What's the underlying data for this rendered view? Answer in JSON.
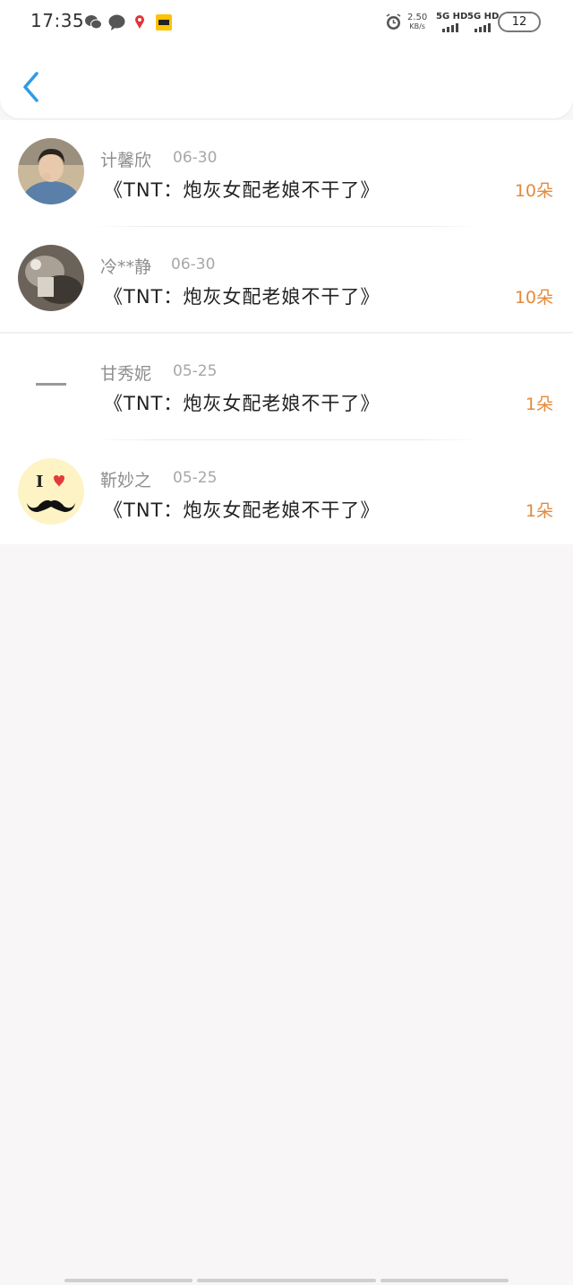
{
  "status_bar": {
    "time": "17:35",
    "net_speed": "2.50",
    "net_unit": "KB/s",
    "sim1_label": "5G HD",
    "sim2_label": "5G HD",
    "battery": "12"
  },
  "colors": {
    "accent_blue": "#2f9be6",
    "count_orange": "#e48a3c"
  },
  "items": [
    {
      "name": "计馨欣",
      "date": "06-30",
      "title": "《TNT：炮灰女配老娘不干了》",
      "count": "10朵"
    },
    {
      "name": "冷**静",
      "date": "06-30",
      "title": "《TNT：炮灰女配老娘不干了》",
      "count": "10朵"
    },
    {
      "name": "甘秀妮",
      "date": "05-25",
      "title": "《TNT：炮灰女配老娘不干了》",
      "count": "1朵"
    },
    {
      "name": "靳妙之",
      "date": "05-25",
      "title": "《TNT：炮灰女配老娘不干了》",
      "count": "1朵"
    }
  ],
  "avatar4_text": "I"
}
